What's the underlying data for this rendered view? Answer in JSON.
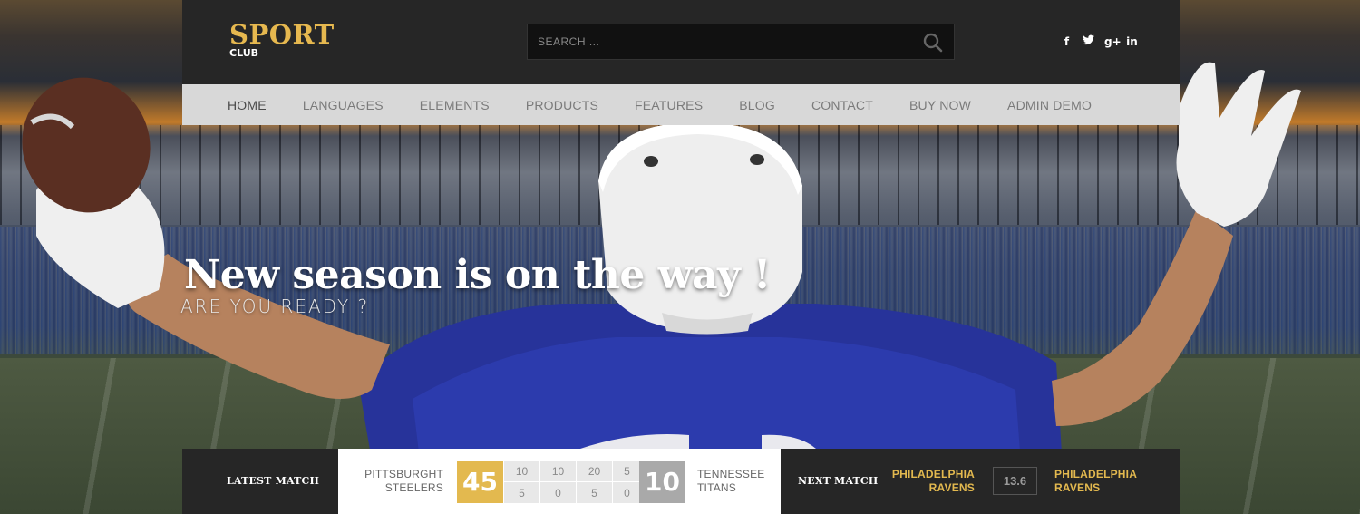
{
  "brand": {
    "name": "SPORT",
    "sub": "CLUB"
  },
  "search": {
    "placeholder": "SEARCH ..."
  },
  "social": [
    {
      "icon": "facebook-icon",
      "glyph": "f"
    },
    {
      "icon": "twitter-icon",
      "glyph": "t"
    },
    {
      "icon": "google-plus-icon",
      "glyph": "g+"
    },
    {
      "icon": "linkedin-icon",
      "glyph": "in"
    }
  ],
  "nav": {
    "items": [
      "HOME",
      "LANGUAGES",
      "ELEMENTS",
      "PRODUCTS",
      "FEATURES",
      "BLOG",
      "CONTACT",
      "BUY NOW",
      "ADMIN DEMO"
    ],
    "active": "HOME"
  },
  "hero": {
    "title": "New season is on the way !",
    "subtitle": "ARE YOU READY ?"
  },
  "latest_match": {
    "label": "LATEST MATCH",
    "home_team": [
      "PITTSBURGHT",
      "STEELERS"
    ],
    "home_score": "45",
    "away_team": [
      "TENNESSEE",
      "TITANS"
    ],
    "away_score": "10",
    "quarters_home": [
      "10",
      "10",
      "20",
      "5"
    ],
    "quarters_away": [
      "5",
      "0",
      "5",
      "0"
    ]
  },
  "next_match": {
    "label": "NEXT MATCH",
    "team_left": [
      "PHILADELPHIA",
      "RAVENS"
    ],
    "date": "13.6",
    "team_right": [
      "PHILADELPHIA",
      "RAVENS"
    ]
  },
  "colors": {
    "accent": "#e3b94f",
    "header_bg": "#262626",
    "nav_bg": "#d8d8d8"
  }
}
